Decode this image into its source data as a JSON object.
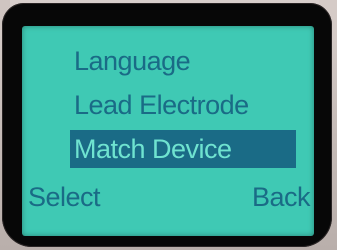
{
  "menu": {
    "items": [
      {
        "label": "Language"
      },
      {
        "label": "Lead Electrode"
      },
      {
        "label": "Match Device"
      }
    ],
    "selected_index": 2
  },
  "softkeys": {
    "left_label": "Select",
    "right_label": "Back"
  },
  "colors": {
    "screen_background": "#3fc9b4",
    "text": "#1a6b86",
    "highlight_background": "#1a6b86",
    "highlight_text": "#6fe3d0",
    "bezel": "#070707"
  }
}
